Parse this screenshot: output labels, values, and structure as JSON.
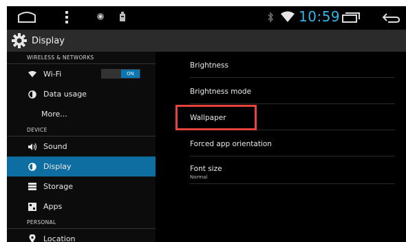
{
  "statusbar": {
    "icons": [
      "home-icon",
      "menu-dots-icon",
      "notification-icon",
      "usb-icon",
      "bluetooth-icon",
      "wifi-icon",
      "recent-apps-icon",
      "back-icon"
    ],
    "clock": "10:59",
    "accent": "#33b5e5"
  },
  "actionbar": {
    "title": "Display",
    "icon": "gear-icon"
  },
  "sidebar": {
    "headers": [
      "WIRELESS & NETWORKS",
      "DEVICE",
      "PERSONAL"
    ],
    "items": [
      {
        "label": "Wi-Fi",
        "icon": "wifi-icon",
        "toggle": "ON"
      },
      {
        "label": "Data usage",
        "icon": "data-usage-icon"
      },
      {
        "label": "More..."
      },
      {
        "label": "Sound",
        "icon": "sound-icon"
      },
      {
        "label": "Display",
        "icon": "display-icon",
        "selected": true
      },
      {
        "label": "Storage",
        "icon": "storage-icon"
      },
      {
        "label": "Apps",
        "icon": "apps-icon"
      },
      {
        "label": "Location",
        "icon": "location-icon"
      }
    ],
    "selected_color": "#0e6ea1"
  },
  "settings": {
    "items": [
      {
        "label": "Brightness"
      },
      {
        "label": "Brightness mode"
      },
      {
        "label": "Wallpaper",
        "highlighted": true
      },
      {
        "label": "Forced app orientation"
      },
      {
        "label": "Font size",
        "summary": "Normal"
      }
    ],
    "highlight_color": "#e8423f"
  }
}
